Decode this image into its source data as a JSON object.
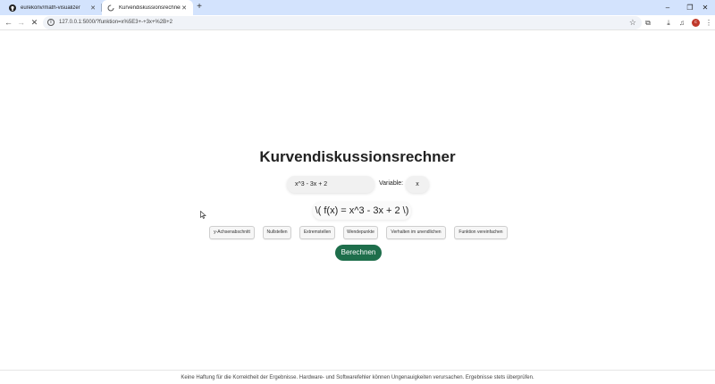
{
  "browser": {
    "tabs": [
      {
        "title": "eurekonv/math-visualizer",
        "icon": "github-icon"
      },
      {
        "title": "Kurvendiskussionsrechner",
        "icon": "loading-icon"
      }
    ],
    "new_tab": "+",
    "window_controls": {
      "minimize": "–",
      "restore": "❐",
      "close": "✕"
    },
    "url": "127.0.0.1:5000/?funktion=x%5E3+-+3x+%2B+2",
    "avatar_letter": "c"
  },
  "page": {
    "title": "Kurvendiskussionsrechner",
    "function_value": "x^3 - 3x + 2",
    "variable_label": "Variable:",
    "variable_value": "x",
    "formula": "\\( f(x) = x^3 - 3x + 2 \\)",
    "options": [
      "y-Achsenabschnitt",
      "Nullstellen",
      "Extremstellen",
      "Wendepunkte",
      "Verhalten im unendlichen",
      "Funktion vereinfachen"
    ],
    "calculate_label": "Berechnen",
    "footer": "Keine Haftung für die Korrektheit der Ergebnisse. Hardware- und Softwarefehler können Ungenauigkeiten verursachen. Ergebnisse stets überprüfen."
  },
  "colors": {
    "accent": "#1e6e4b",
    "tabbar": "#d3e3fd"
  }
}
